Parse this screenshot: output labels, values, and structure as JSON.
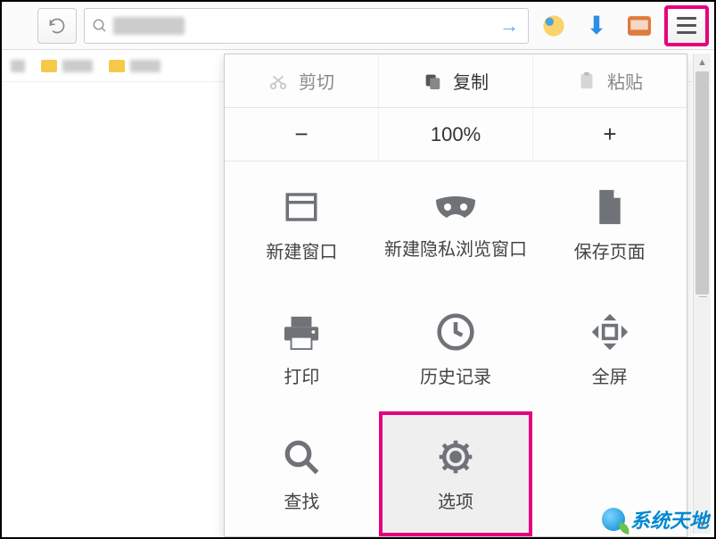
{
  "toolbar": {
    "search_placeholder": "",
    "search_value": ""
  },
  "clipboard": {
    "cut": "剪切",
    "copy": "复制",
    "paste": "粘贴"
  },
  "zoom": {
    "minus": "−",
    "level": "100%",
    "plus": "+"
  },
  "menu": {
    "new_window": "新建窗口",
    "new_private": "新建隐私浏览窗口",
    "save_page": "保存页面",
    "print": "打印",
    "history": "历史记录",
    "fullscreen": "全屏",
    "find": "查找",
    "options": "选项"
  },
  "watermark": "系统天地"
}
